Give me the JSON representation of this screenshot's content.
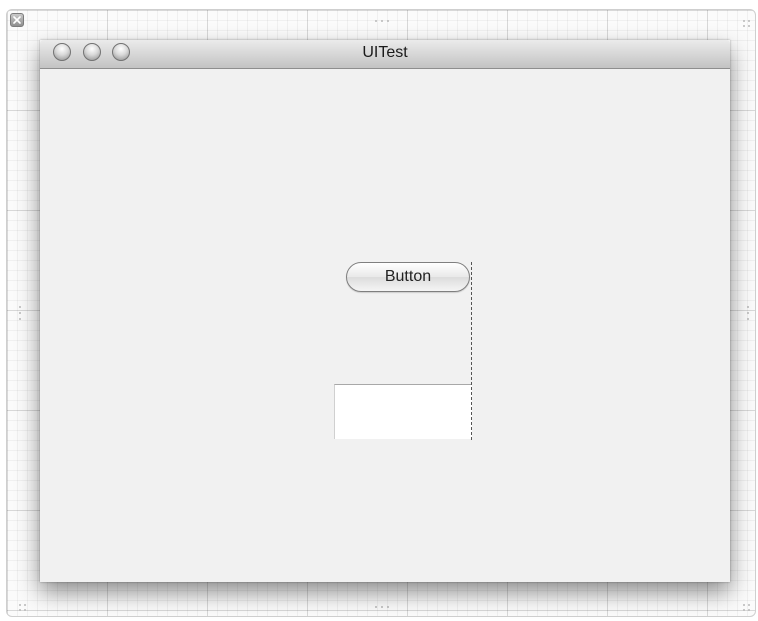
{
  "window": {
    "title": "UITest"
  },
  "controls": {
    "button_label": "Button"
  },
  "icons": {
    "canvas_close": "close-icon",
    "window_close": "close-icon",
    "window_minimize": "minimize-icon",
    "window_zoom": "zoom-icon"
  },
  "colors": {
    "window_background": "#f1f1f1",
    "canvas_grid": "#e6e6e6",
    "guide_line": "#555555"
  }
}
